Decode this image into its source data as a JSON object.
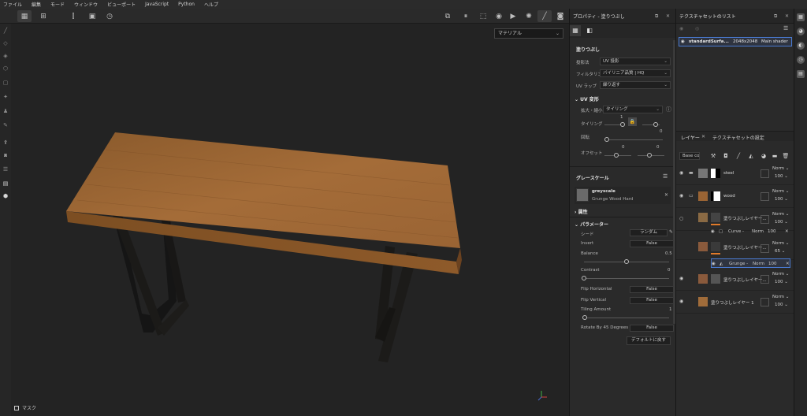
{
  "menu": [
    "ファイル",
    "編集",
    "モード",
    "ウィンドウ",
    "ビューポート",
    "JavaScript",
    "Python",
    "ヘルプ"
  ],
  "viewport": {
    "material_dropdown": "マテリアル",
    "mask_label": "マスク"
  },
  "properties": {
    "title": "プロパティ - 塗りつぶし",
    "section_fill": "塗りつぶし",
    "projection_label": "投影法",
    "projection_value": "UV 投影",
    "filtering_label": "フィルタリング",
    "filtering_value": "バイリニア品質 | HQ",
    "uv_wrap_label": "UV ラップ",
    "uv_wrap_value": "繰り返す",
    "uv_transform_title": "UV 変形",
    "scale_label": "拡大・縮小",
    "scale_value": "タイリング",
    "tiling_label": "タイリング",
    "tiling_value": "1",
    "rotation_label": "回転",
    "rotation_value": "0",
    "offset_label": "オフセット",
    "offset_value_x": "0",
    "offset_value_y": "0",
    "grayscale_title": "グレースケール",
    "grayscale_name": "greyscale",
    "grayscale_sub": "Grunge Wood Hard",
    "attributes_title": "属性",
    "parameters_title": "パラメーター",
    "seed_label": "シード",
    "seed_value": "ランダム",
    "invert_label": "Invert",
    "invert_value": "False",
    "balance_label": "Balance",
    "balance_value": "0.5",
    "balance_level": 0.5,
    "contrast_label": "Contrast",
    "contrast_value": "0",
    "contrast_level": 0,
    "flip_h_label": "Flip Horizontal",
    "flip_h_value": "False",
    "flip_v_label": "Flip Vertical",
    "flip_v_value": "False",
    "tiling_amount_label": "Tiling Amount",
    "tiling_amount_value": "1",
    "rotate45_label": "Rotate By 45 Degrees",
    "rotate45_value": "False",
    "reset_button": "デフォルトに戻す"
  },
  "texture_list": {
    "title": "テクスチャセットのリスト",
    "item_name": "standardSurfa...",
    "item_size": "2048x2048",
    "item_shader": "Main shader"
  },
  "layers_panel": {
    "tab_layers": "レイヤー",
    "tab_settings": "テクスチャセットの設定",
    "channel_dd": "Base co",
    "layers": [
      {
        "name": "steel",
        "blend": "Norm",
        "opacity": "100"
      },
      {
        "name": "wood",
        "blend": "Norm",
        "opacity": "100"
      },
      {
        "name": "塗りつぶしレイヤー...",
        "blend": "Norm",
        "opacity": "100"
      },
      {
        "name": "塗りつぶしレイヤー...",
        "blend": "Norm",
        "opacity": "65"
      },
      {
        "name": "塗りつぶしレイヤー...",
        "blend": "Norm",
        "opacity": "100"
      },
      {
        "name": "塗りつぶしレイヤー 1",
        "blend": "Norm",
        "opacity": "100"
      }
    ],
    "sub_curve": {
      "name": "Curve -",
      "blend": "Norm",
      "opacity": "100"
    },
    "sub_grunge": {
      "name": "Grunge -",
      "blend": "Norm",
      "opacity": "100"
    }
  }
}
